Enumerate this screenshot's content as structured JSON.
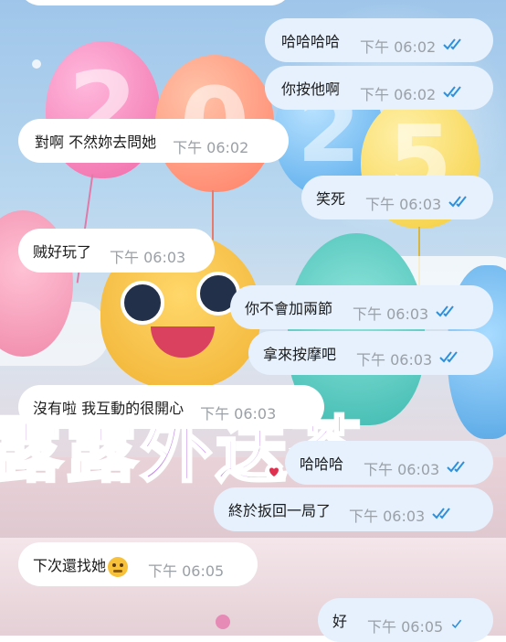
{
  "wallpaper": {
    "headline": "露露外送茶",
    "balloon_digits": [
      "2",
      "0",
      "2",
      "5"
    ]
  },
  "colors": {
    "incoming_bubble": "#ffffff",
    "outgoing_bubble": "#e6f1fd",
    "read_check": "#2f8fd8",
    "timestamp": "#9aa0a6"
  },
  "messages": [
    {
      "direction": "out",
      "text": "哈哈哈哈",
      "time": "下午 06:02",
      "status": "read-double-check-icon"
    },
    {
      "direction": "out",
      "text": "你按他啊",
      "time": "下午 06:02",
      "status": "read-double-check-icon"
    },
    {
      "direction": "in",
      "text": "對啊 不然妳去問她",
      "time": "下午 06:02"
    },
    {
      "direction": "out",
      "text": "笑死",
      "time": "下午 06:03",
      "status": "read-double-check-icon"
    },
    {
      "direction": "in",
      "text": "贼好玩了",
      "time": "下午 06:03"
    },
    {
      "direction": "out",
      "text": "你不會加兩節",
      "time": "下午 06:03",
      "status": "read-double-check-icon"
    },
    {
      "direction": "out",
      "text": "拿來按摩吧",
      "time": "下午 06:03",
      "status": "read-double-check-icon"
    },
    {
      "direction": "in",
      "text": "沒有啦 我互動的很開心",
      "time": "下午 06:03"
    },
    {
      "direction": "out",
      "text": "哈哈哈",
      "time": "下午 06:03",
      "status": "read-double-check-icon",
      "reaction": "heart-icon"
    },
    {
      "direction": "out",
      "text": "終於扳回一局了",
      "time": "下午 06:03",
      "status": "read-double-check-icon"
    },
    {
      "direction": "in",
      "text": "下次還找她",
      "time": "下午 06:05",
      "emoji": "thinking-face-emoji"
    },
    {
      "direction": "out",
      "text": "好",
      "time": "下午 06:05",
      "status": "sent-single-check-icon"
    }
  ]
}
